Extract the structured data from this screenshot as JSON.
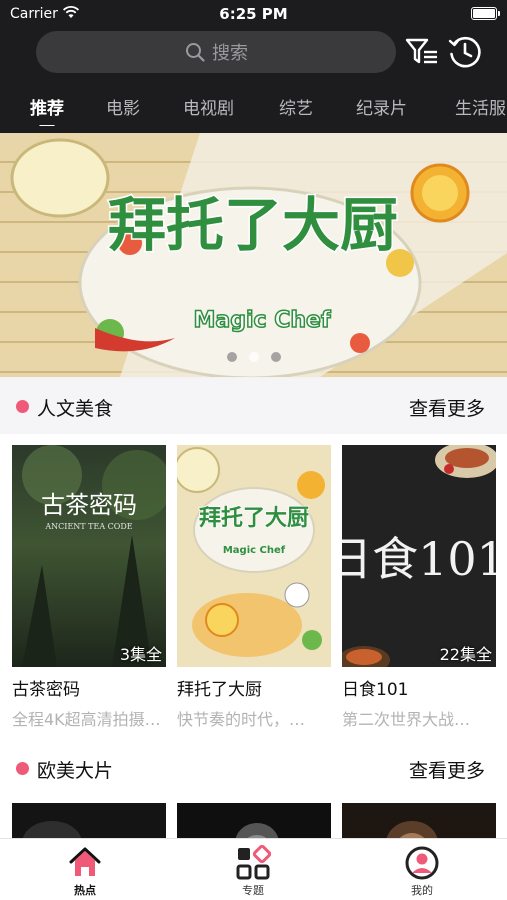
{
  "status_bar": {
    "carrier": "Carrier",
    "time": "6:25 PM"
  },
  "search": {
    "placeholder": "搜索"
  },
  "tabs": [
    {
      "label": "推荐",
      "active": true
    },
    {
      "label": "电影"
    },
    {
      "label": "电视剧"
    },
    {
      "label": "综艺"
    },
    {
      "label": "纪录片"
    },
    {
      "label": "生活服"
    }
  ],
  "banner": {
    "title_cn": "拜托了大厨",
    "title_en": "Magic Chef",
    "slide_count": 3,
    "active_slide": 2
  },
  "sections": [
    {
      "title": "人文美食",
      "more": "查看更多",
      "items": [
        {
          "name": "古茶密码",
          "desc": "全程4K超高清拍摄…",
          "episodes": "3集全",
          "poster_title": "古茶密码",
          "poster_sub": "ANCIENT TEA CODE"
        },
        {
          "name": "拜托了大厨",
          "desc": "快节奏的时代，…",
          "episodes": "",
          "poster_title": "拜托了大厨",
          "poster_sub": "Magic Chef"
        },
        {
          "name": "日食101",
          "desc": "第二次世界大战…",
          "episodes": "22集全",
          "poster_title": "日食101",
          "poster_sub": ""
        }
      ]
    },
    {
      "title": "欧美大片",
      "more": "查看更多"
    }
  ],
  "tabbar": [
    {
      "label": "热点",
      "icon": "home-icon",
      "active": true
    },
    {
      "label": "专题",
      "icon": "grid-icon"
    },
    {
      "label": "我的",
      "icon": "profile-icon"
    }
  ],
  "colors": {
    "accent": "#ef5a78",
    "header_bg": "#1c1c1e",
    "search_bg": "#3a3a3c"
  }
}
